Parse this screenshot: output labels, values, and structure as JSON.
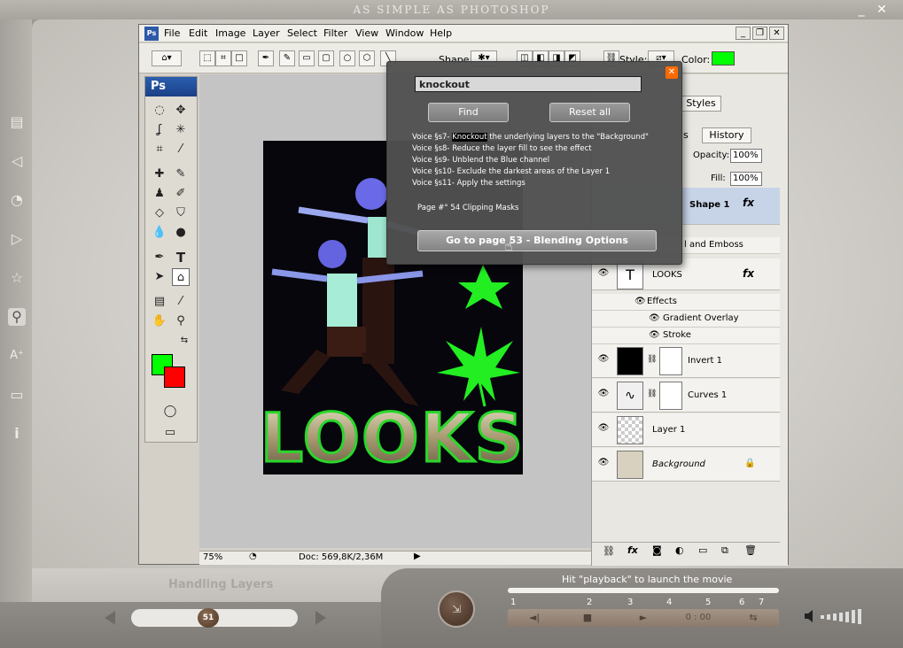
{
  "app": {
    "title": "AS SIMPLE AS PHOTOSHOP",
    "minimize": "_",
    "close": "✕"
  },
  "sidebar_icons": [
    "list-icon",
    "back-icon",
    "audio-icon",
    "play-icon",
    "star-icon",
    "search-icon",
    "text-size-icon",
    "print-icon",
    "info-icon"
  ],
  "sidebar_glyphs": {
    "list": "▤",
    "back": "◁",
    "audio": "◔",
    "play": "▷",
    "star": "☆",
    "search": "⚲",
    "text_size": "A⁺",
    "print": "▭",
    "info": "i"
  },
  "bottom": {
    "section_label": "Handling Layers",
    "page_number": "51",
    "hint": "Hit \"playback\" to launch the movie",
    "ticks": [
      "1",
      "2",
      "3",
      "4",
      "5",
      "6",
      "7"
    ],
    "time": "0 : 00",
    "round_button_glyph": "⇲",
    "transport": {
      "rewind": "◄|",
      "stop": "■",
      "play": "►",
      "loop": "⇆"
    }
  },
  "photoshop": {
    "logo": "Ps",
    "menu": [
      "File",
      "Edit",
      "Image",
      "Layer",
      "Select",
      "Filter",
      "View",
      "Window",
      "Help"
    ],
    "window_buttons": [
      "_",
      "❐",
      "✕"
    ],
    "options": {
      "shape_label": "Shape:",
      "style_label": "Style:",
      "color_label": "Color:",
      "color": "#00ff00"
    },
    "toolbox_title": "Ps",
    "fg_color": "#00ff00",
    "bg_color": "#ff0000",
    "status": {
      "zoom": "75%",
      "doc": "Doc: 569,8K/2,36M"
    },
    "canvas_text": "LOOKS",
    "panels": {
      "tab_styles": "Styles",
      "tab_paths": "ls",
      "tab_history": "History",
      "opacity_label": "Opacity:",
      "opacity": "100%",
      "fill_label": "Fill:",
      "fill": "100%"
    },
    "layers": [
      {
        "name": "Shape 1",
        "fx": "fx"
      },
      {
        "name": "l and Emboss"
      },
      {
        "name": "LOOKS",
        "fx": "fx"
      },
      {
        "name": "Effects"
      },
      {
        "name": "Gradient Overlay"
      },
      {
        "name": "Stroke"
      },
      {
        "name": "Invert 1"
      },
      {
        "name": "Curves 1"
      },
      {
        "name": "Layer 1"
      },
      {
        "name": "Background"
      }
    ],
    "layer_footer_icons": [
      "link-icon",
      "fx-icon",
      "mask-icon",
      "adjustment-icon",
      "folder-icon",
      "new-layer-icon",
      "trash-icon"
    ]
  },
  "search_popup": {
    "query": "knockout",
    "find_label": "Find",
    "reset_label": "Reset all",
    "results": [
      {
        "prefix": "Voice §s7-  ",
        "highlight": "Knockout",
        "suffix": " the underlying layers to the \"Background\""
      },
      {
        "prefix": "Voice §s8-  ",
        "highlight": "",
        "suffix": "Reduce the layer fill to see the effect"
      },
      {
        "prefix": "Voice §s9-  ",
        "highlight": "",
        "suffix": "Unblend the Blue channel"
      },
      {
        "prefix": "Voice §s10-  ",
        "highlight": "",
        "suffix": "Exclude the darkest areas of the Layer 1"
      },
      {
        "prefix": "Voice §s11-  ",
        "highlight": "",
        "suffix": "Apply the settings"
      }
    ],
    "page_ref": "Page  #° 54  Clipping Masks",
    "goto_label": "Go to page 53  -  Blending Options"
  }
}
